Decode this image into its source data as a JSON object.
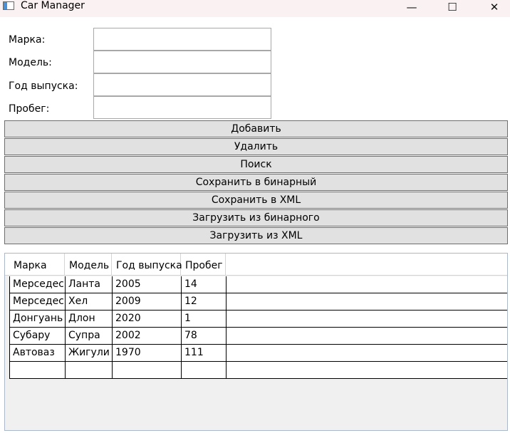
{
  "window": {
    "title": "Car Manager",
    "minimize_glyph": "—",
    "maximize_glyph": "☐",
    "close_glyph": "✕"
  },
  "form": {
    "brand_label": "Марка:",
    "model_label": "Модель:",
    "year_label": "Год выпуска:",
    "mileage_label": "Пробег:",
    "brand_value": "",
    "model_value": "",
    "year_value": "",
    "mileage_value": ""
  },
  "buttons": {
    "add": "Добавить",
    "delete": "Удалить",
    "search": "Поиск",
    "save_binary": "Сохранить в бинарный",
    "save_xml": "Сохранить в XML",
    "load_binary": "Загрузить из бинарного",
    "load_xml": "Загрузить из XML"
  },
  "grid": {
    "columns": [
      "Марка",
      "Модель",
      "Год выпуска",
      "Пробег"
    ],
    "rows": [
      [
        "Мерседес",
        "Ланта",
        "2005",
        "14"
      ],
      [
        "Мерседес",
        "Хел",
        "2009",
        "12"
      ],
      [
        "Донгуань",
        "Длон",
        "2020",
        "1"
      ],
      [
        "Субару",
        "Супра",
        "2002",
        "78"
      ],
      [
        "Автоваз",
        "Жигули",
        "1970",
        "111"
      ],
      [
        "",
        "",
        "",
        ""
      ]
    ]
  }
}
